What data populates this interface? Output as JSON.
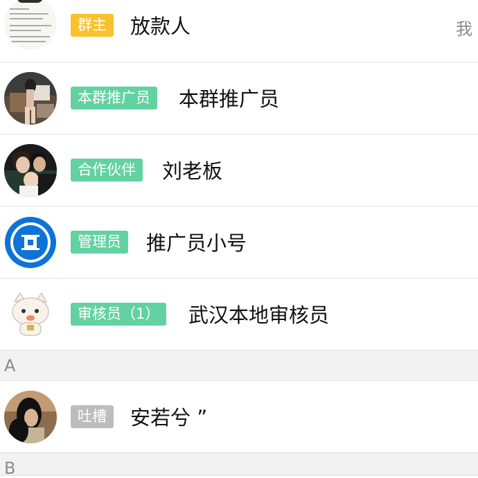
{
  "members": [
    {
      "badge": "群主",
      "badge_color": "#f8c12d",
      "name": "放款人",
      "me_label": "我",
      "avatar_icon": "notice-image-avatar"
    },
    {
      "badge": "本群推广员",
      "badge_color": "#62d2a2",
      "name": "本群推广员",
      "avatar_icon": "person-photo-avatar"
    },
    {
      "badge": "合作伙伴",
      "badge_color": "#62d2a2",
      "name": "刘老板",
      "avatar_icon": "family-photo-avatar"
    },
    {
      "badge": "管理员",
      "badge_color": "#62d2a2",
      "name": "推广员小号",
      "avatar_icon": "blue-coin-icon"
    },
    {
      "badge": "审核员（1）",
      "badge_color": "#62d2a2",
      "name": "武汉本地审核员",
      "avatar_icon": "cartoon-cat-avatar"
    }
  ],
  "section_a": "A",
  "section_a_members": [
    {
      "badge": "吐槽",
      "badge_color": "#bdbdbd",
      "name": "安若兮 ”",
      "avatar_icon": "woman-photo-avatar"
    }
  ],
  "section_b": "B"
}
